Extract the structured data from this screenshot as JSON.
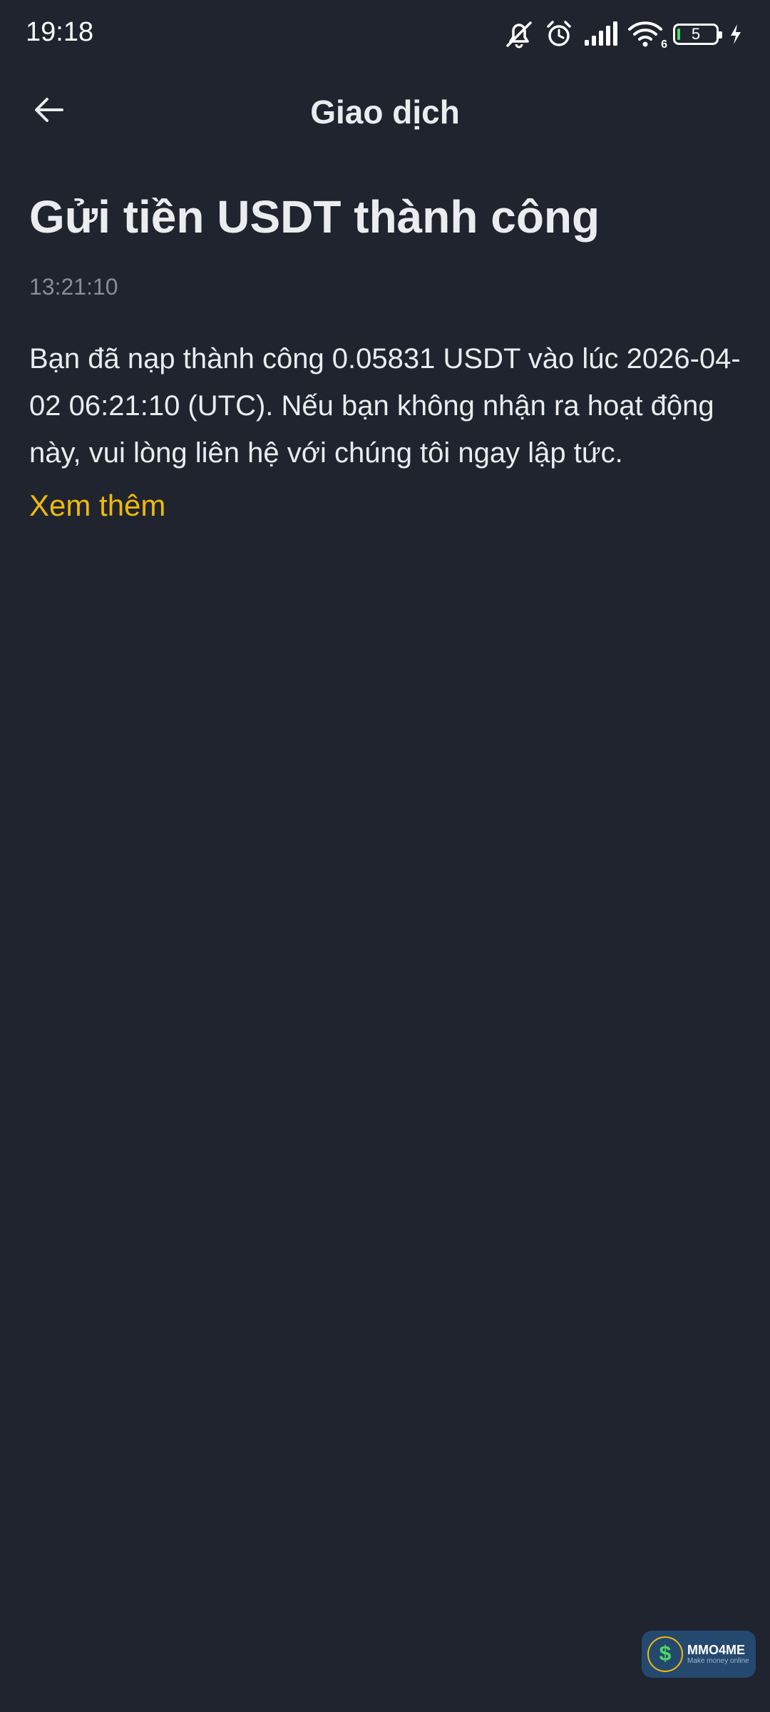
{
  "status_bar": {
    "time": "19:18",
    "icons": [
      "mute-icon",
      "alarm-icon",
      "signal-icon",
      "wifi-icon",
      "battery-icon",
      "charging-icon"
    ],
    "wifi_badge": "6",
    "battery_level": "5"
  },
  "header": {
    "back_icon": "arrow-left-icon",
    "title": "Giao dịch"
  },
  "notification": {
    "title": "Gửi tiền USDT thành công",
    "time": "13:21:10",
    "message": "Bạn đã nạp thành công 0.05831 USDT vào lúc 2026-04-02 06:21:10 (UTC). Nếu bạn không nhận ra hoạt động này, vui lòng liên hệ với chúng tôi ngay lập tức.",
    "more_label": "Xem thêm"
  },
  "watermark": {
    "symbol": "$",
    "brand": "MMO4ME",
    "tagline": "Make money online"
  },
  "colors": {
    "background": "#1f242e",
    "text": "#eaecef",
    "muted": "#848e9c",
    "accent": "#f0b90b"
  }
}
